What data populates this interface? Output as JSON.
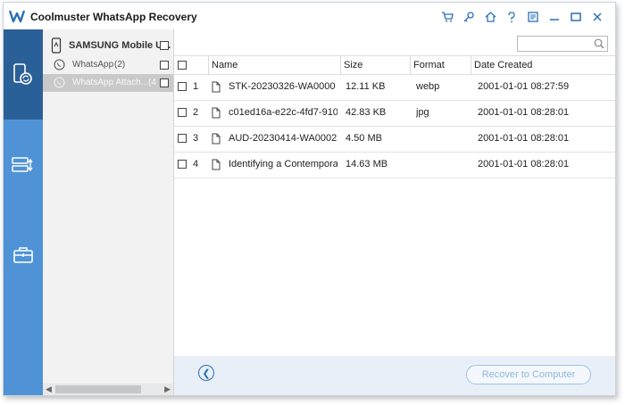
{
  "app": {
    "title": "Coolmuster WhatsApp Recovery"
  },
  "titlebar_icons": [
    "cart-icon",
    "key-icon",
    "home-icon",
    "help-icon",
    "feedback-icon",
    "minimize-icon",
    "maximize-icon",
    "close-icon"
  ],
  "leftnav": {
    "items": [
      "phone-recovery-icon",
      "backup-restore-icon",
      "toolbox-icon"
    ],
    "active_index": 0
  },
  "tree": {
    "device": "SAMSUNG Mobile U...",
    "items": [
      {
        "label": "WhatsApp",
        "count": "(2)",
        "selected": false
      },
      {
        "label": "WhatsApp Attach...",
        "count": "(4",
        "selected": true
      }
    ]
  },
  "search": {
    "placeholder": ""
  },
  "table": {
    "columns": [
      "Name",
      "Size",
      "Format",
      "Date Created"
    ],
    "rows": [
      {
        "index": "1",
        "name": "STK-20230326-WA0000",
        "size": "12.11 KB",
        "format": "webp",
        "date": "2001-01-01 08:27:59"
      },
      {
        "index": "2",
        "name": "c01ed16a-e22c-4fd7-910f-a...",
        "size": "42.83 KB",
        "format": "jpg",
        "date": "2001-01-01 08:28:01"
      },
      {
        "index": "3",
        "name": "AUD-20230414-WA0002",
        "size": "4.50 MB",
        "format": "",
        "date": "2001-01-01 08:28:01"
      },
      {
        "index": "4",
        "name": "Identifying a Contemporary ...",
        "size": "14.63 MB",
        "format": "",
        "date": "2001-01-01 08:28:01"
      }
    ]
  },
  "footer": {
    "recover_label": "Recover to Computer"
  },
  "colors": {
    "nav_bg": "#4f93d6",
    "nav_active": "#2b5f97",
    "accent": "#2a6fb5"
  }
}
